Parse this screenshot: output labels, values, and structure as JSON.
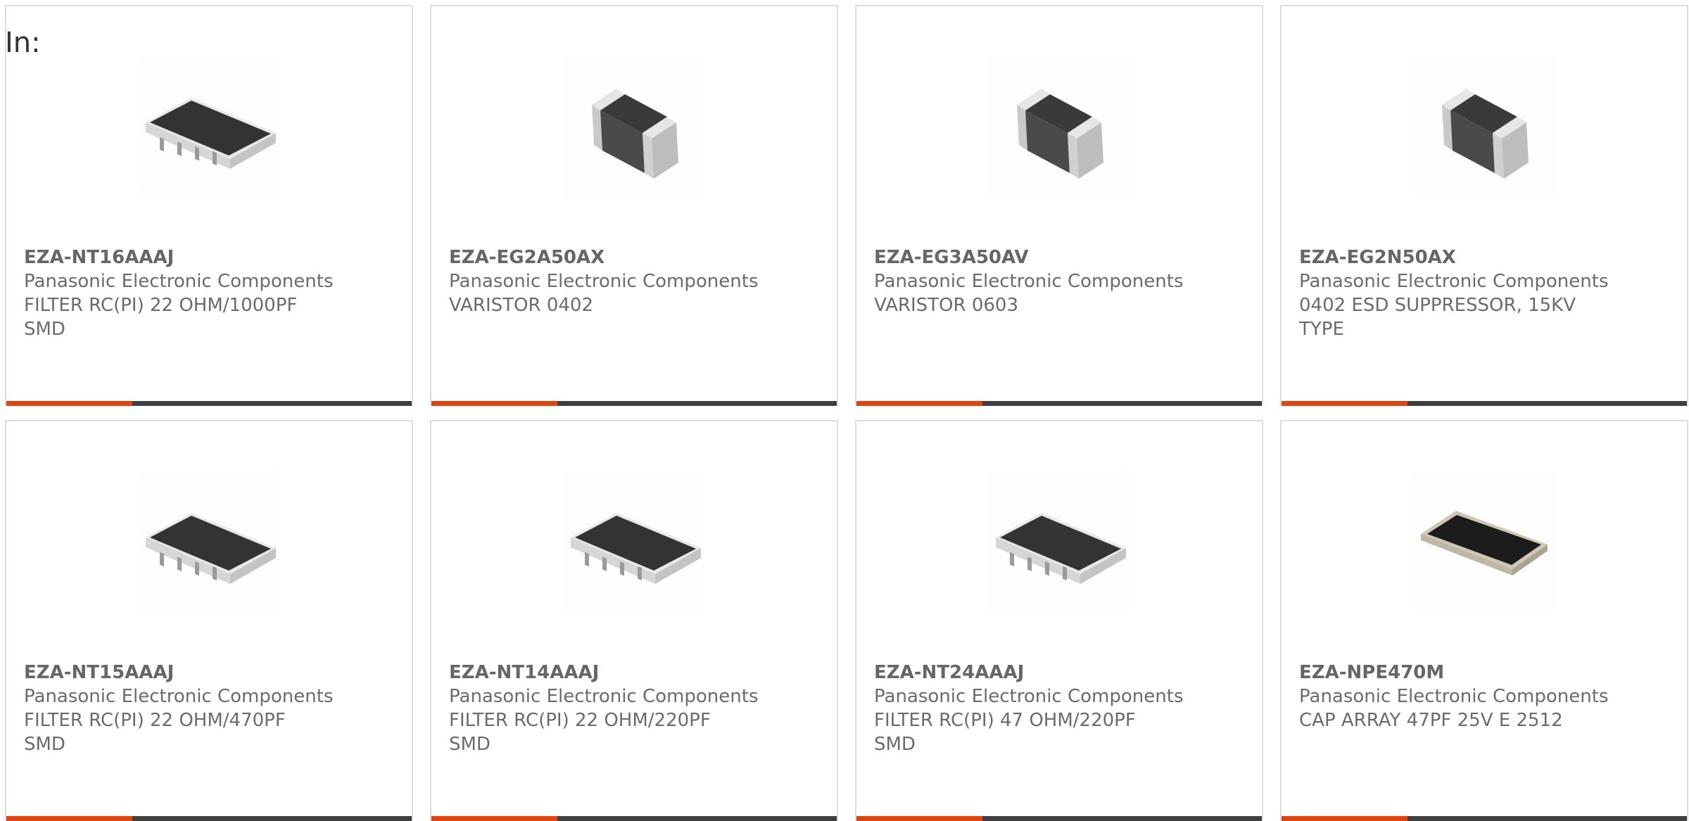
{
  "header": {
    "label": "In:"
  },
  "colors": {
    "accent": "#e24410",
    "bar": "#3f3f3f",
    "text": "#6b6b6b"
  },
  "products": [
    {
      "part_number": "EZA-NT16AAAJ",
      "manufacturer": "Panasonic Electronic Components",
      "description": "FILTER RC(PI) 22 OHM/1000PF SMD",
      "image_icon": "filter-array-chip-icon",
      "accent_fill": 0.31
    },
    {
      "part_number": "EZA-EG2A50AX",
      "manufacturer": "Panasonic Electronic Components",
      "description": "VARISTOR 0402",
      "image_icon": "chip-component-icon",
      "accent_fill": 0.31
    },
    {
      "part_number": "EZA-EG3A50AV",
      "manufacturer": "Panasonic Electronic Components",
      "description": "VARISTOR 0603",
      "image_icon": "chip-component-icon",
      "accent_fill": 0.31
    },
    {
      "part_number": "EZA-EG2N50AX",
      "manufacturer": "Panasonic Electronic Components",
      "description": "0402 ESD SUPPRESSOR, 15KV TYPE",
      "image_icon": "chip-component-icon",
      "accent_fill": 0.31
    },
    {
      "part_number": "EZA-NT15AAAJ",
      "manufacturer": "Panasonic Electronic Components",
      "description": "FILTER RC(PI) 22 OHM/470PF SMD",
      "image_icon": "filter-array-chip-icon",
      "accent_fill": 0.31
    },
    {
      "part_number": "EZA-NT14AAAJ",
      "manufacturer": "Panasonic Electronic Components",
      "description": "FILTER RC(PI) 22 OHM/220PF SMD",
      "image_icon": "filter-array-chip-icon",
      "accent_fill": 0.31
    },
    {
      "part_number": "EZA-NT24AAAJ",
      "manufacturer": "Panasonic Electronic Components",
      "description": "FILTER RC(PI) 47 OHM/220PF SMD",
      "image_icon": "filter-array-chip-icon",
      "accent_fill": 0.31
    },
    {
      "part_number": "EZA-NPE470M",
      "manufacturer": "Panasonic Electronic Components",
      "description": "CAP ARRAY 47PF 25V E 2512",
      "image_icon": "cap-array-chip-icon",
      "accent_fill": 0.31
    }
  ]
}
